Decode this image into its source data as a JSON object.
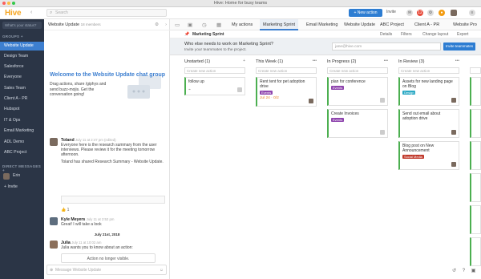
{
  "window": {
    "title": "Hive: Home for busy teams"
  },
  "topbar": {
    "logo": "Hive",
    "back": "‹",
    "search_placeholder": "Search",
    "new_action": "+ New action",
    "invite": "Invite",
    "notif_count": "12"
  },
  "sidebar": {
    "status_placeholder": "What's your status?",
    "groups_header": "GROUPS +",
    "groups": [
      "Website Update",
      "Design Team",
      "Salesforce",
      "Everyone",
      "Sales Team",
      "Client A - PR",
      "Hubspot",
      "IT & Ops",
      "Email Marketing",
      "ADL Demo",
      "ABC Project"
    ],
    "dm_header": "DIRECT MESSAGES +",
    "dm_user": "Erin",
    "invite_link": "+ Invite"
  },
  "chat": {
    "title": "Website Update",
    "members": "18 members",
    "welcome_title": "Welcome to the Website Update chat group",
    "welcome_text": "Drag actions, share /giphys and send buzz-mojis. Get the conversation going!",
    "messages": [
      {
        "author": "Toland",
        "time": "July 11 at 2:47 pm (edited)",
        "lines": [
          "Everyone here is the research summary from the user interviews. Please review it for the meeting tomorrow afternoon.",
          "Toland has shared Research Summary - Website Update."
        ]
      },
      {
        "author": "Kyle Meyers",
        "time": "July 11 at 2:52 pm",
        "lines": [
          "Great! I will take a look"
        ]
      },
      {
        "author": "Julia",
        "time": "July 11 at 10:02 am",
        "lines": [
          "Julia wants you to know about an action:"
        ]
      }
    ],
    "reaction": "👍 1",
    "day_separator": "July 21st, 2018",
    "action_box": "Action no longer visible.",
    "input_placeholder": "Message Website Update"
  },
  "main": {
    "tabs": [
      "My actions",
      "Marketing Sprint",
      "Email Marketing",
      "Website Update",
      "ABC Project",
      "Client A - PR",
      "Website Pro"
    ],
    "active_tab": "Marketing Sprint",
    "project_title": "Marketing Sprint",
    "tools": [
      "Details",
      "Filters",
      "Change layout",
      "Export"
    ],
    "banner_question": "Who else needs to work on Marketing Sprint?",
    "banner_sub": "Invite your teammates to the project.",
    "email_placeholder": "jane@hive.com",
    "invite_button": "Invite teammates",
    "new_action_placeholder": "Create new action",
    "columns": [
      {
        "title": "Unstarted (1)",
        "cards": [
          {
            "text": "follow up",
            "tag": "",
            "meta": ""
          }
        ]
      },
      {
        "title": "This Week (1)",
        "cards": [
          {
            "text": "Rent tent for pet adoption drive",
            "tag": "Events",
            "meta": "Jul 24 · 0/2"
          }
        ]
      },
      {
        "title": "In Progress (2)",
        "cards": [
          {
            "text": "plan for conference",
            "tag": "Events",
            "meta": ""
          },
          {
            "text": "Create Invoices",
            "tag": "Events",
            "meta": ""
          }
        ]
      },
      {
        "title": "In Review (3)",
        "cards": [
          {
            "text": "Assets for new landing page on Blog",
            "tag": "Design",
            "meta": ""
          },
          {
            "text": "Send out email about adoption drive",
            "tag": "",
            "meta": ""
          },
          {
            "text": "Blog post on New Announcement",
            "tag": "Social Media",
            "meta": ""
          }
        ]
      }
    ]
  },
  "colors": {
    "accent": "#3d7fd0",
    "sidebar": "#2b3546",
    "logo": "#f5a623",
    "events_tag": "#8e44ad",
    "design_tag": "#2aa8c4",
    "social_tag": "#c0392b"
  }
}
